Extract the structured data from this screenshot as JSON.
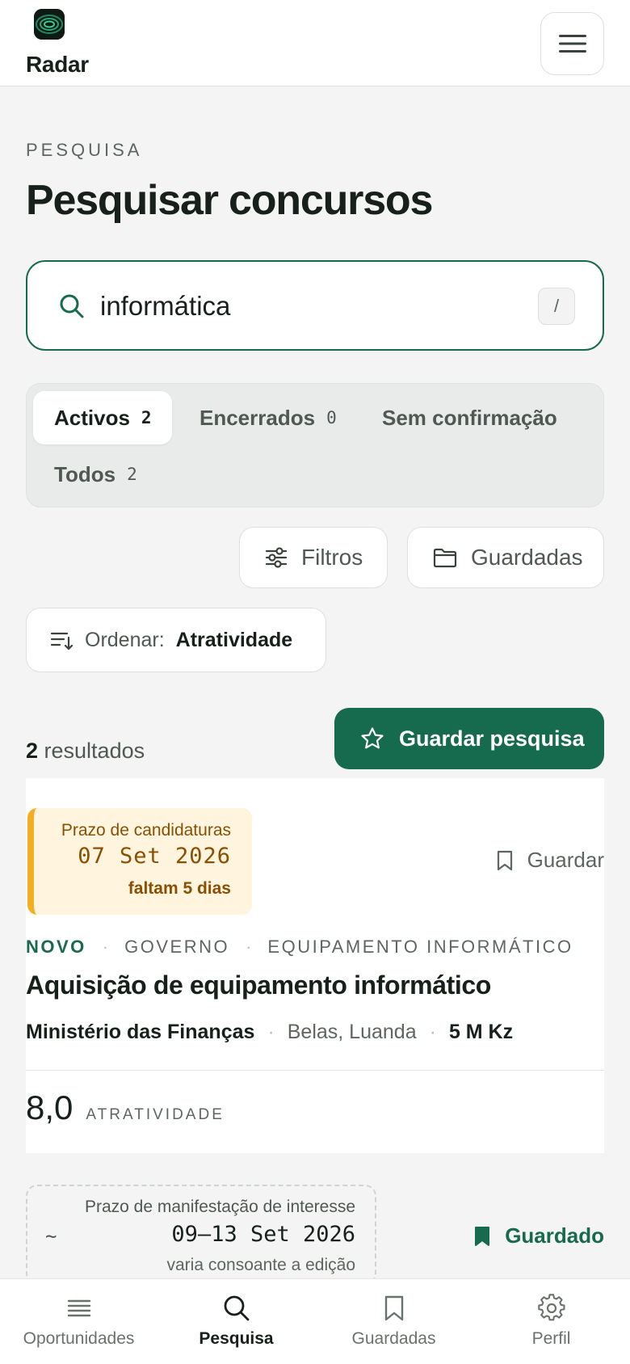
{
  "header": {
    "brand": "Radar",
    "menu_icon": "hamburger-menu-icon"
  },
  "page": {
    "eyebrow": "PESQUISA",
    "title": "Pesquisar concursos"
  },
  "search": {
    "value": "informática",
    "shortcut": "/",
    "icon": "search-icon"
  },
  "tabs": [
    {
      "label": "Activos",
      "count": "2",
      "active": true
    },
    {
      "label": "Encerrados",
      "count": "0",
      "active": false
    },
    {
      "label": "Sem confirmação",
      "count": "",
      "active": false
    },
    {
      "label": "Todos",
      "count": "2",
      "active": false
    }
  ],
  "toolbar": {
    "filters_label": "Filtros",
    "saved_label": "Guardadas",
    "sort_prefix": "Ordenar:",
    "sort_value": "Atratividade"
  },
  "results": {
    "count": "2",
    "count_suffix": " resultados",
    "save_search_label": "Guardar pesquisa"
  },
  "cards": [
    {
      "deadline_label": "Prazo de candidaturas",
      "deadline_date": "07 Set 2026",
      "deadline_remaining": "faltam 5 dias",
      "bookmark_label": "Guardar",
      "tag_new": "NOVO",
      "tag_sector": "GOVERNO",
      "tag_category": "EQUIPAMENTO INFORMÁTICO",
      "title": "Aquisição de equipamento informático",
      "organization": "Ministério das Finanças",
      "location": "Belas, Luanda",
      "value": "5 M Kz",
      "score": "8,0",
      "score_label": "ATRATIVIDADE"
    },
    {
      "deadline_prefix": "~",
      "deadline_label": "Prazo de manifestação de interesse",
      "deadline_date": "09–13 Set 2026",
      "deadline_note": "varia consoante a edição",
      "bookmark_label": "Guardado"
    }
  ],
  "bottom_nav": [
    {
      "label": "Oportunidades",
      "icon": "list-icon",
      "active": false
    },
    {
      "label": "Pesquisa",
      "icon": "search-icon",
      "active": true
    },
    {
      "label": "Guardadas",
      "icon": "bookmark-icon",
      "active": false
    },
    {
      "label": "Perfil",
      "icon": "gear-icon",
      "active": false
    }
  ],
  "colors": {
    "accent": "#166a4d",
    "deadline_bg": "#fff4de",
    "deadline_bar": "#f4ae22",
    "deadline_text": "#8a4f00"
  }
}
